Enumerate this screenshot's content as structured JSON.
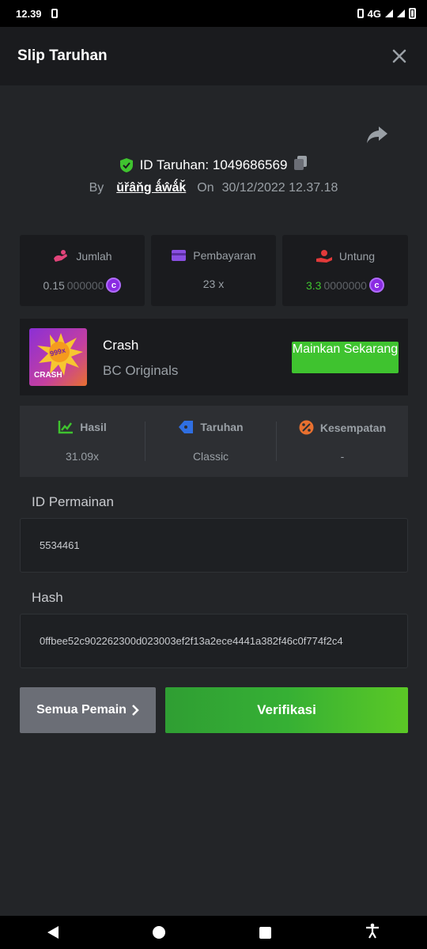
{
  "status_bar": {
    "time": "12.39",
    "network": "4G"
  },
  "header": {
    "title": "Slip Taruhan"
  },
  "bet": {
    "id_text": "ID Taruhan: 1049686569",
    "by_label": "By",
    "username": "ŭřâňg ǻŵǻǩ",
    "on_label": "On",
    "datetime": "30/12/2022 12.37.18"
  },
  "stats": {
    "amount": {
      "label": "Jumlah",
      "value_main": "0.15",
      "value_dim": "000000"
    },
    "payout": {
      "label": "Pembayaran",
      "value": "23 x"
    },
    "profit": {
      "label": "Untung",
      "value_main": "3.3",
      "value_dim": "0000000"
    }
  },
  "game": {
    "thumb_multiplier": "999x",
    "thumb_label": "CRASH",
    "name": "Crash",
    "provider": "BC Originals",
    "play_button": "Mainkan Sekarang"
  },
  "result": {
    "hasil": {
      "label": "Hasil",
      "value": "31.09x"
    },
    "taruhan": {
      "label": "Taruhan",
      "value": "Classic"
    },
    "kesempatan": {
      "label": "Kesempatan",
      "value": "-"
    }
  },
  "game_id": {
    "label": "ID Permainan",
    "value": "5534461"
  },
  "hash": {
    "label": "Hash",
    "value": "0ffbee52c902262300d023003ef2f13a2ece4441a382f46c0f774f2c4"
  },
  "buttons": {
    "all_players": "Semua Pemain",
    "verify": "Verifikasi"
  },
  "colors": {
    "accent_green": "#3fc32f",
    "background": "#232528",
    "card": "#1a1b1e",
    "coin_purple": "#8a2be2"
  }
}
